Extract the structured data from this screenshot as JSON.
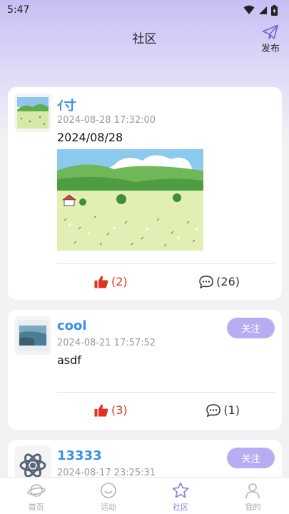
{
  "status_bar": {
    "time": "5:47"
  },
  "header": {
    "title": "社区",
    "publish_label": "发布"
  },
  "posts": [
    {
      "username": "ｲ寸",
      "time": "2024-08-28 17:32:00",
      "text": "2024/08/28",
      "likes": "(2)",
      "comments": "(26)"
    },
    {
      "username": "cool",
      "time": "2024-08-21 17:57:52",
      "text": "asdf",
      "follow_label": "关注",
      "likes": "(3)",
      "comments": "(1)"
    },
    {
      "username": "13333",
      "time": "2024-08-17 23:25:31",
      "follow_label": "关注"
    }
  ],
  "tabbar": {
    "items": [
      {
        "label": "首页",
        "icon": "planet-icon"
      },
      {
        "label": "活动",
        "icon": "smile-icon"
      },
      {
        "label": "社区",
        "icon": "star-icon",
        "active": true
      },
      {
        "label": "我的",
        "icon": "person-icon"
      }
    ]
  },
  "colors": {
    "accent": "#8a7de8",
    "username": "#3b8ee8",
    "like": "#e0301e",
    "follow_button": "#b8adf3"
  }
}
